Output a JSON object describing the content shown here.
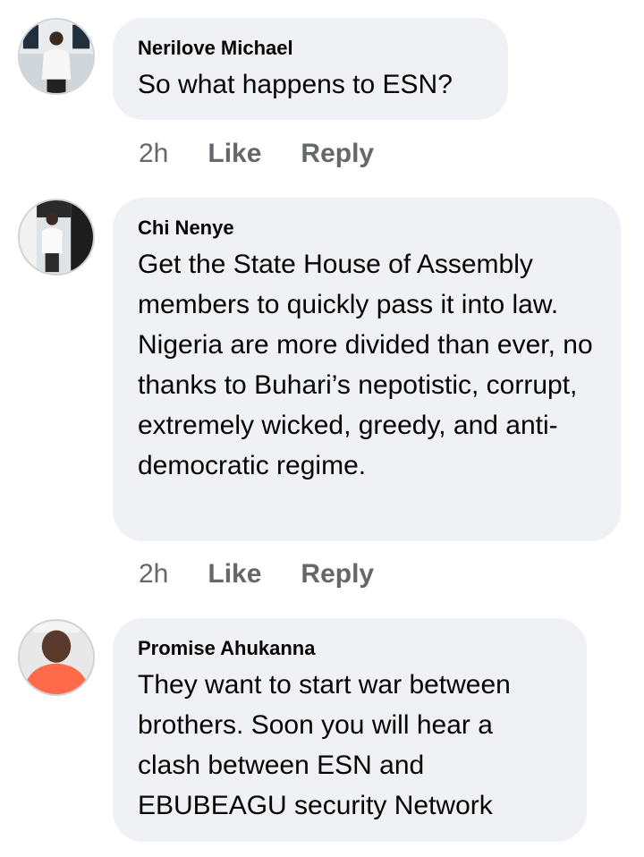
{
  "comments": [
    {
      "author": "Nerilove Michael",
      "text": "So what happens to ESN?",
      "time": "2h",
      "like_label": "Like",
      "reply_label": "Reply"
    },
    {
      "author": "Chi Nenye",
      "text": "Get the State House of Assembly members to quickly pass it into law. Nigeria are more divided than ever, no thanks to Buhari’s nepotistic, corrupt, extremely wicked, greedy, and anti-democratic regime.",
      "time": "2h",
      "like_label": "Like",
      "reply_label": "Reply"
    },
    {
      "author": "Promise Ahukanna",
      "text": "They want to start war between brothers. Soon you will hear a clash between ESN and EBUBEAGU security Network"
    }
  ],
  "colors": {
    "bubble": "#eff1f4",
    "meta": "#65676b",
    "text": "#050505"
  }
}
